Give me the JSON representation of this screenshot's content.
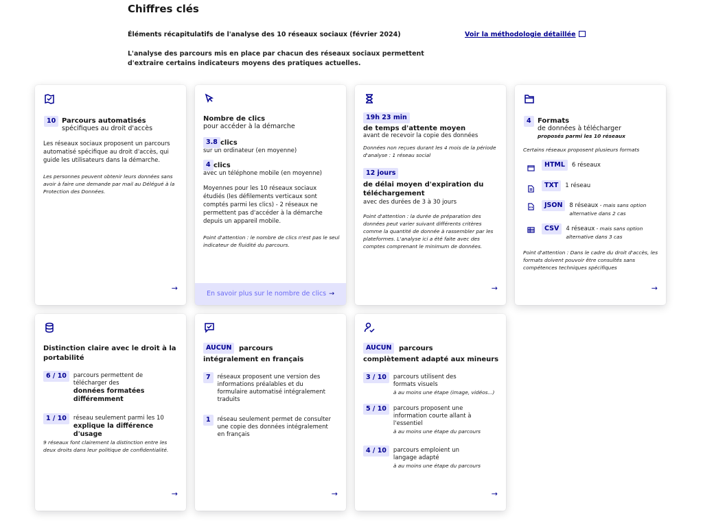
{
  "header": {
    "title": "Chiffres clés",
    "subtitle": "Éléments récapitulatifs de l'analyse des 10 réseaux sociaux (février 2024)",
    "methodology_link": "Voir la méthodologie détaillée",
    "description": "L'analyse des parcours mis en place par chacun des réseaux sociaux permettent d'extraire certains indicateurs moyens des pratiques actuelles."
  },
  "cards": {
    "parcours": {
      "icon": "map-icon",
      "badge": "10",
      "title": "Parcours automatisés",
      "subtitle": "spécifiques au droit d'accès",
      "text": "Les réseaux sociaux proposent un parcours automatisé spécifique au droit d'accès, qui guide les utilisateurs dans la démarche.",
      "note": "Les personnes peuvent obtenir leurs données sans avoir à faire une demande par mail au Délégué à la Protection des Données."
    },
    "clics": {
      "icon": "cursor-icon",
      "title": "Nombre de clics",
      "subtitle": "pour accéder à la démarche",
      "desktop_value": "3.8",
      "desktop_unit": "clics",
      "desktop_label": "sur un ordinateur (en moyenne)",
      "mobile_value": "4",
      "mobile_unit": "clics",
      "mobile_label": "avec un téléphone mobile (en moyenne)",
      "text": "Moyennes pour les 10 réseaux sociaux étudiés (les défilements verticaux sont comptés parmi les clics) - 2 réseaux ne permettent pas d'accéder à la démarche depuis un appareil mobile.",
      "note": "Point d'attention : le nombre de clics n'est pas le seul indicateur de fluidité du parcours.",
      "more_link": "En savoir plus sur le nombre de clics"
    },
    "attente": {
      "icon": "hourglass-icon",
      "badge1": "19h 23 min",
      "title1": "de temps d'attente moyen",
      "subtitle1": "avant de recevoir la copie des données",
      "note1": "Données non reçues durant les 4 mois de la période d'analyse : 1 réseau social",
      "badge2": "12 jours",
      "title2": "de délai moyen d'expiration du téléchargement",
      "subtitle2": "avec des durées de 3 à 30 jours",
      "note2": "Point d'attention : la durée de préparation des données peut varier suivant différents critères comme la quantité de donnée à rassembler par les plateformes. L'analyse ici a été faite avec des comptes comprenant le minimum de données."
    },
    "formats": {
      "icon": "folder-icon",
      "badge": "4",
      "title": "Formats",
      "subtitle": "de données à télécharger",
      "subtitle_it": "proposés parmi les 10 réseaux",
      "note_top": "Certains réseaux proposent plusieurs formats",
      "items": [
        {
          "icon": "window-icon",
          "label": "HTML",
          "text": "6 réseaux",
          "extra": ""
        },
        {
          "icon": "file-text-icon",
          "label": "TXT",
          "text": "1 réseau",
          "extra": ""
        },
        {
          "icon": "file-code-icon",
          "label": "JSON",
          "text": "8 réseaux",
          "extra": " - mais sans option alternative dans 2 cas"
        },
        {
          "icon": "table-icon",
          "label": "CSV",
          "text": "4 réseaux",
          "extra": " - mais sans option alternative dans 3 cas"
        }
      ],
      "note": "Point d'attention : Dans le cadre du droit d'accès, les formats doivent pouvoir être consultés sans compétences techniques spécifiques"
    },
    "portabilite": {
      "icon": "database-icon",
      "title": "Distinction claire avec le droit à la portabilité",
      "row1_badge": "6 / 10",
      "row1_text": "parcours permettent de télécharger des",
      "row1_bold": "données formatées différemment",
      "row2_badge": "1 / 10",
      "row2_text": "réseau seulement parmi les 10",
      "row2_bold": "explique la différence d'usage",
      "note": "9 réseaux font clairement la distinction entre les deux droits dans leur politique de confidentialité."
    },
    "francais": {
      "icon": "chat-check-icon",
      "badge": "AUCUN",
      "title_a": "parcours",
      "title_b": "intégralement en français",
      "row1_badge": "7",
      "row1_text": "réseaux proposent une version des informations préalables et du formulaire automatisé intégralement traduits",
      "row2_badge": "1",
      "row2_text": "réseau seulement permet de consulter une copie des données intégralement en français"
    },
    "mineurs": {
      "icon": "user-check-icon",
      "badge": "AUCUN",
      "title_a": "parcours",
      "title_b": "complètement adapté aux mineurs",
      "rows": [
        {
          "badge": "3 / 10",
          "text": "parcours utilisent des formats visuels",
          "note": "à au moins une étape (image, vidéos...)"
        },
        {
          "badge": "5 / 10",
          "text": "parcours proposent une information courte allant à l'essentiel",
          "note": "à au moins une étape du parcours"
        },
        {
          "badge": "4 / 10",
          "text": "parcours emploient un langage adapté",
          "note": "à au moins une étape du parcours"
        }
      ]
    }
  },
  "arrow": "→"
}
